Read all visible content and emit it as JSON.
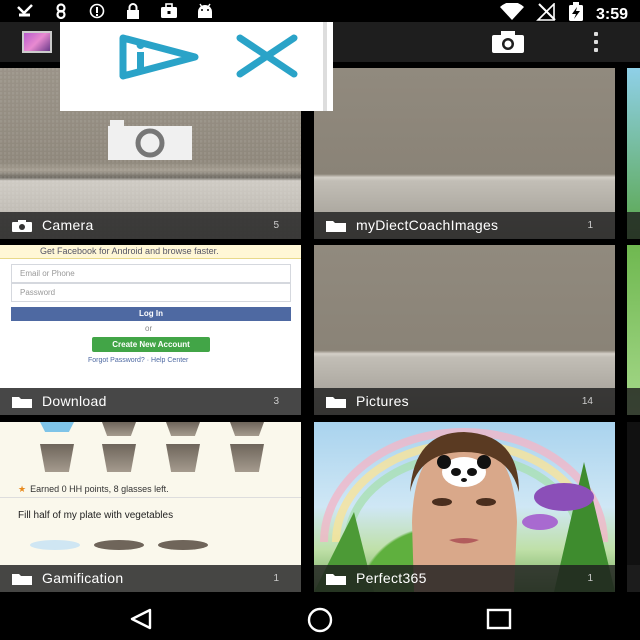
{
  "status_bar": {
    "time": "3:59",
    "left_icons": [
      "missed-call-icon",
      "infinity-icon",
      "blocked-icon",
      "lock-icon",
      "briefcase-icon",
      "android-icon"
    ],
    "right_icons": [
      "wifi-icon",
      "no-signal-icon",
      "battery-charging-icon"
    ]
  },
  "action_bar": {
    "icons": [
      "album-thumbnail-icon",
      "camera-icon",
      "overflow-menu-icon"
    ]
  },
  "ad_banner": {
    "icons": [
      "ad-choices-icon",
      "close-icon"
    ]
  },
  "albums": [
    {
      "name": "Camera",
      "count": "5",
      "icon": "camera-icon"
    },
    {
      "name": "myDiectCoachImages",
      "count": "1",
      "icon": "folder-icon"
    },
    {
      "name": "Download",
      "count": "3",
      "icon": "folder-icon"
    },
    {
      "name": "Pictures",
      "count": "14",
      "icon": "folder-icon"
    },
    {
      "name": "Gamification",
      "count": "1",
      "icon": "folder-icon"
    },
    {
      "name": "Perfect365",
      "count": "1",
      "icon": "folder-icon"
    }
  ],
  "download_thumb": {
    "banner": "Get Facebook for Android and browse faster.",
    "email_placeholder": "Email or Phone",
    "password_placeholder": "Password",
    "login": "Log In",
    "or": "or",
    "create": "Create New Account",
    "forgot": "Forgot Password? · Help Center"
  },
  "gamification_thumb": {
    "earned": "Earned 0 HH points, 8 glasses left.",
    "fill_text": "Fill half of my plate with vegetables"
  },
  "nav_bar": {
    "icons": [
      "back-icon",
      "home-icon",
      "recents-icon"
    ]
  }
}
